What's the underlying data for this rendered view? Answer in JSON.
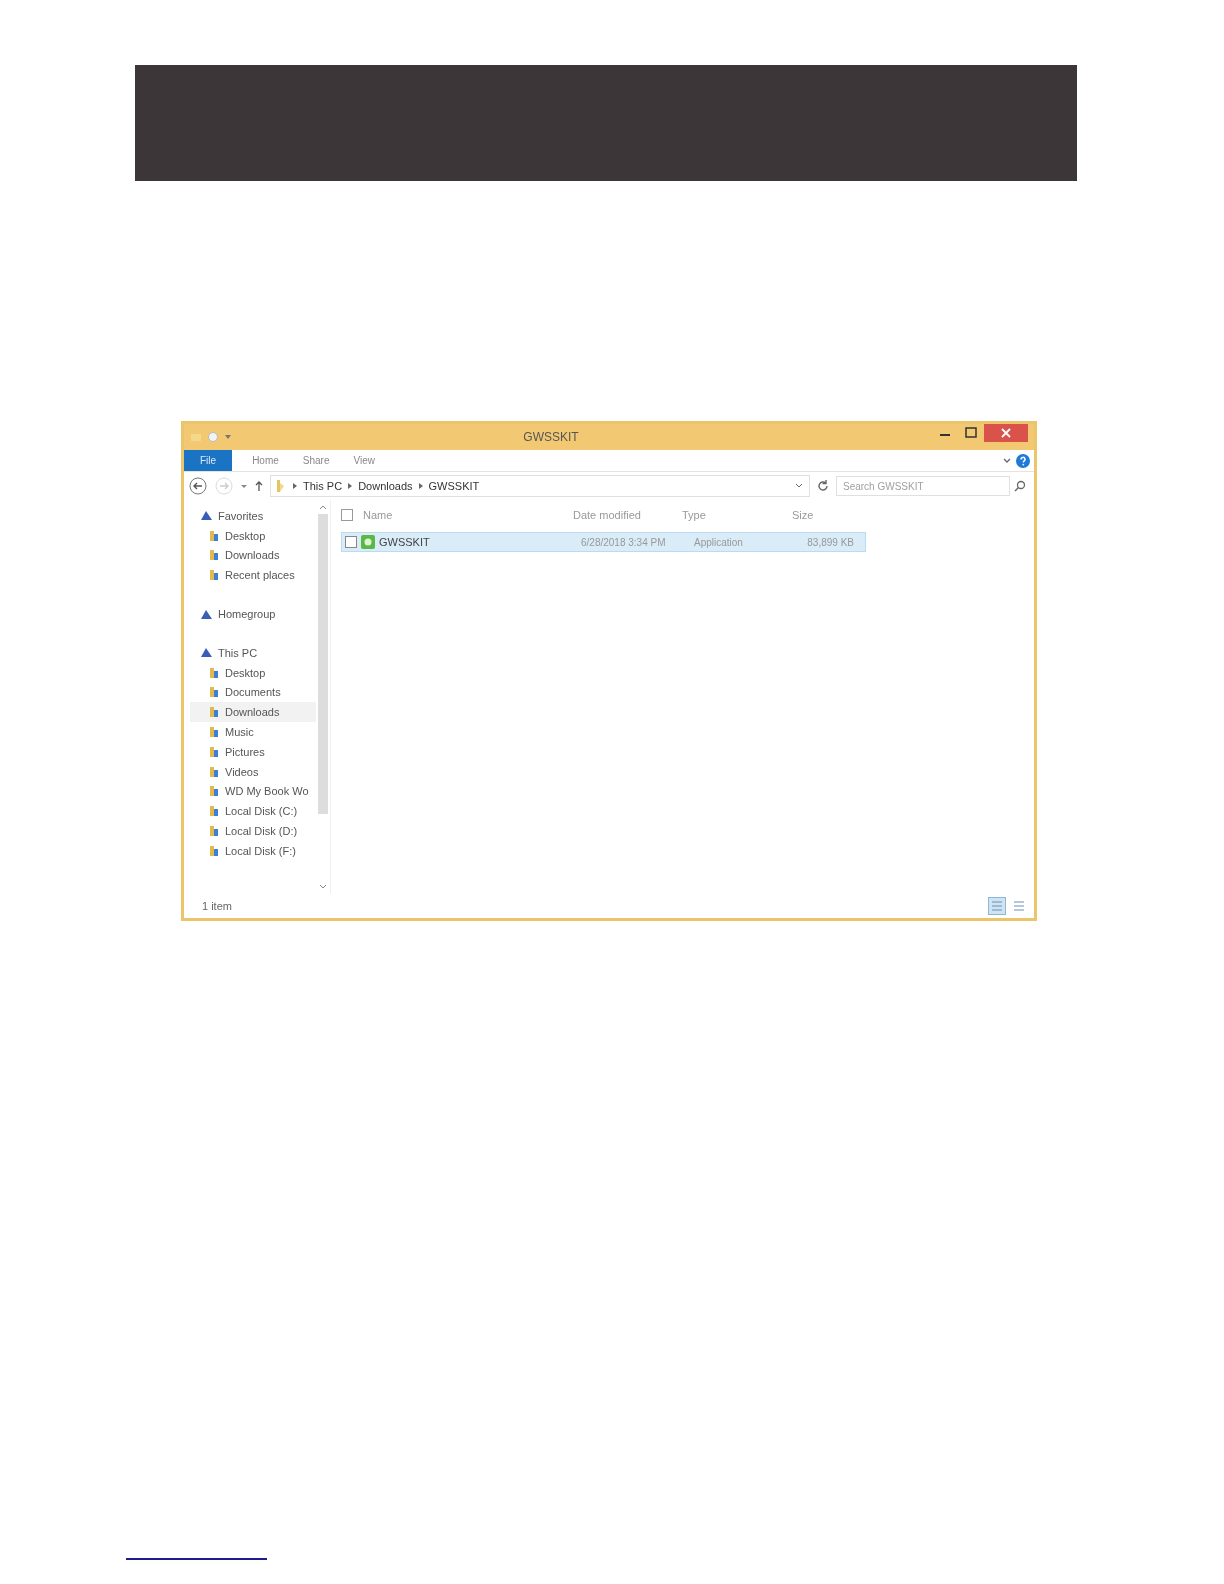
{
  "window": {
    "title": "GWSSKIT"
  },
  "tabs": [
    {
      "label": "File",
      "selected": true
    },
    {
      "label": "Home",
      "selected": false
    },
    {
      "label": "Share",
      "selected": false
    },
    {
      "label": "View",
      "selected": false
    }
  ],
  "breadcrumb": [
    "This PC",
    "Downloads",
    "GWSSKIT"
  ],
  "search": {
    "placeholder": "Search GWSSKIT"
  },
  "sidebar": {
    "items": [
      {
        "label": "Favorites",
        "selected": false,
        "children": [
          {
            "label": "Desktop",
            "selected": false
          },
          {
            "label": "Downloads",
            "selected": false
          },
          {
            "label": "Recent places",
            "selected": false
          }
        ]
      },
      {
        "label": "Homegroup",
        "selected": false
      },
      {
        "label": "This PC",
        "selected": false,
        "children": [
          {
            "label": "Desktop",
            "selected": false
          },
          {
            "label": "Documents",
            "selected": false
          },
          {
            "label": "Downloads",
            "selected": true
          },
          {
            "label": "Music",
            "selected": false
          },
          {
            "label": "Pictures",
            "selected": false
          },
          {
            "label": "Videos",
            "selected": false
          },
          {
            "label": "WD My Book Wo",
            "selected": false
          },
          {
            "label": "Local Disk (C:)",
            "selected": false
          },
          {
            "label": "Local Disk (D:)",
            "selected": false
          },
          {
            "label": "Local Disk (F:)",
            "selected": false
          }
        ]
      }
    ]
  },
  "table": {
    "select_all": {
      "checked": false
    },
    "columns": [
      "Name",
      "Date modified",
      "Type",
      "Size"
    ],
    "rows": [
      {
        "name": "GWSSKIT",
        "date": "6/28/2018 3:34 PM",
        "type": "Application",
        "size": "83,899 KB",
        "selected": true,
        "checked": false
      }
    ]
  },
  "status_bar": {
    "text": "1 item",
    "views": [
      {
        "selected": true
      },
      {
        "selected": false
      }
    ]
  }
}
